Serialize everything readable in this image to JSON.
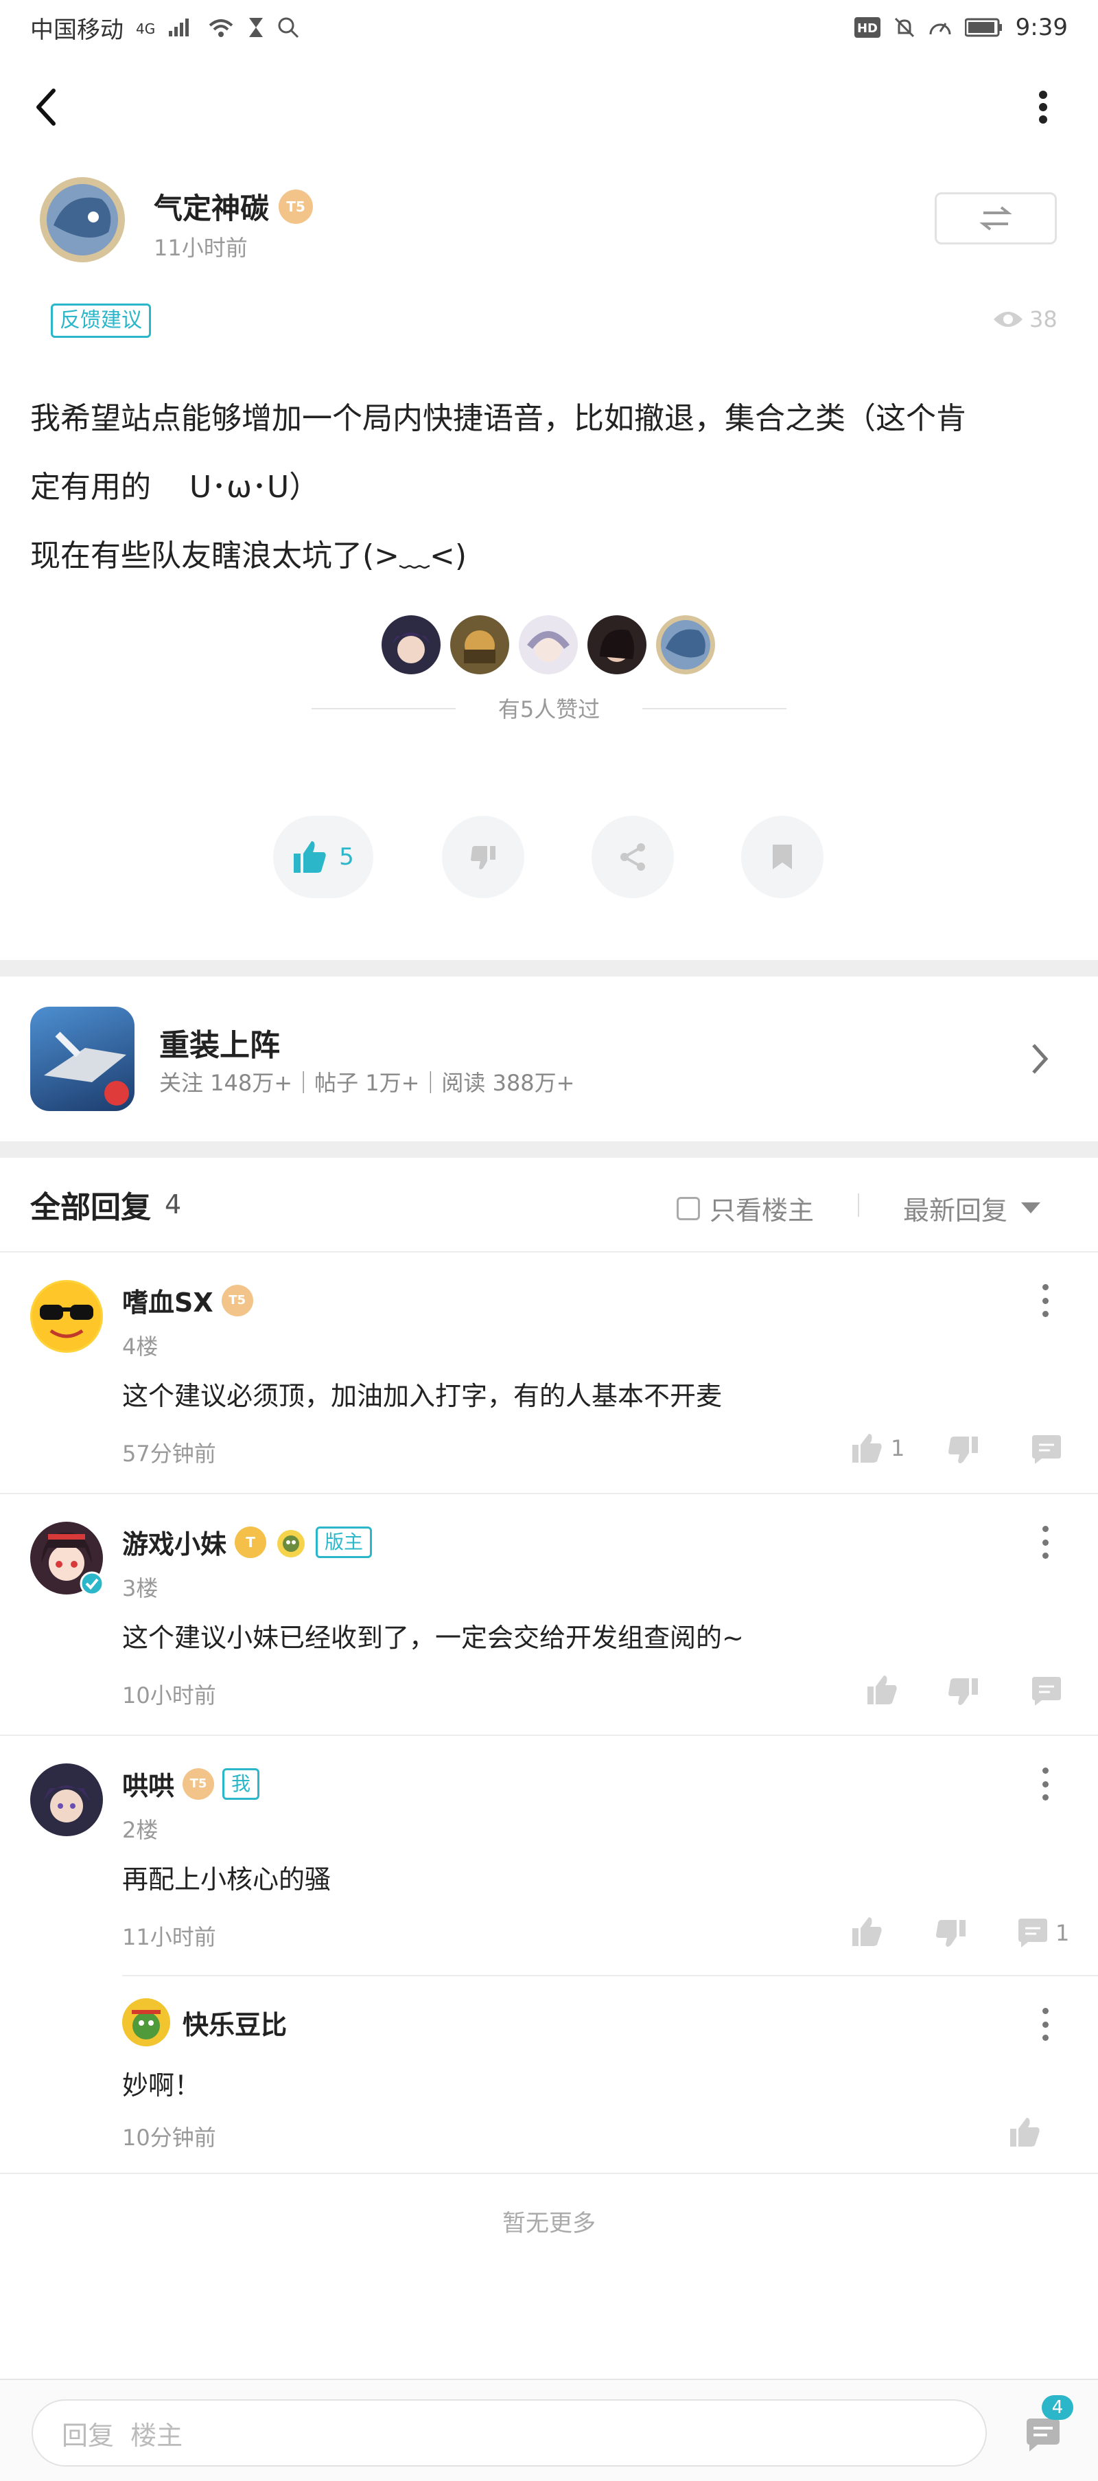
{
  "status_bar": {
    "carrier": "中国移动",
    "network": "4G",
    "time": "9:39"
  },
  "post": {
    "author": {
      "name": "气定神碳",
      "level": "T5",
      "time_ago": "11小时前"
    },
    "tag": "反馈建议",
    "views": "38",
    "content_line1": "我希望站点能够增加一个局内快捷语音，比如撤退，集合之类（这个肯",
    "content_line2": "定有用的    U･ω･U）",
    "content_line3": "现在有些队友瞎浪太坑了(>﹏<)",
    "liked_by_label": "有5人赞过",
    "like_count": "5"
  },
  "game_card": {
    "title": "重装上阵",
    "stats": "关注 148万+｜帖子 1万+｜阅读 388万+"
  },
  "replies_header": {
    "title": "全部回复",
    "count": "4",
    "only_op_label": "只看楼主",
    "sort_label": "最新回复"
  },
  "replies": [
    {
      "name": "嗜血SX",
      "level": "T5",
      "floor": "4楼",
      "content": "这个建议必须顶，加油加入打字，有的人基本不开麦",
      "time": "57分钟前",
      "likes": "1"
    },
    {
      "name": "游戏小妹",
      "level": "T",
      "badge": "版主",
      "floor": "3楼",
      "content": "这个建议小妹已经收到了，一定会交给开发组查阅的~",
      "time": "10小时前"
    },
    {
      "name": "哄哄",
      "level": "T5",
      "badge": "我",
      "floor": "2楼",
      "content": "再配上小核心的骚",
      "time": "11小时前",
      "comments": "1"
    }
  ],
  "sub_reply": {
    "name": "快乐豆比",
    "content": "妙啊！",
    "time": "10分钟前"
  },
  "no_more": "暂无更多",
  "bottom_bar": {
    "placeholder": "回复  楼主",
    "comment_badge": "4"
  },
  "colors": {
    "accent": "#2bb6c9",
    "level_badge": "#f3c489",
    "muted": "#999999"
  }
}
